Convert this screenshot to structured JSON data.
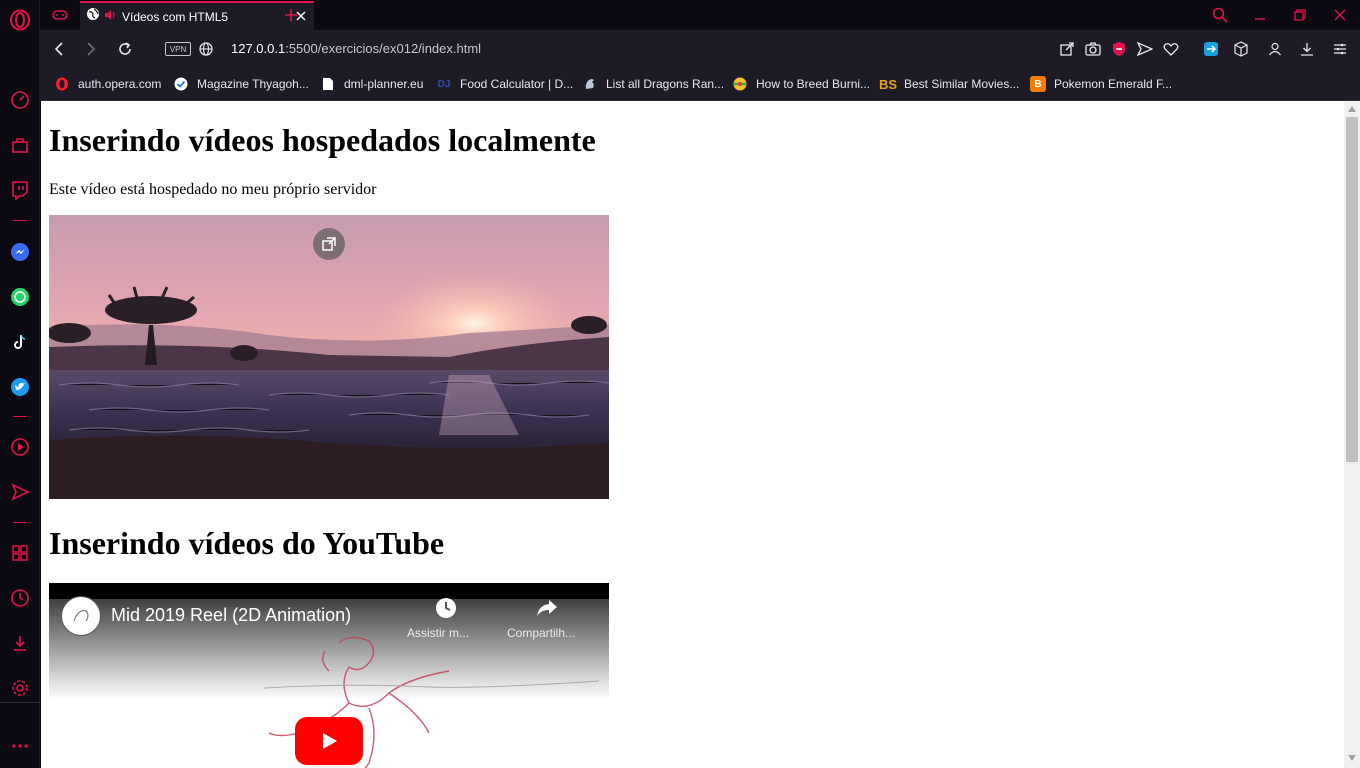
{
  "browser": {
    "tab": {
      "title": "Vídeos com HTML5"
    },
    "address": {
      "host": "127.0.0.1",
      "path": ":5500/exercicios/ex012/index.html",
      "vpn_label": "VPN"
    },
    "bookmarks": [
      {
        "label": "auth.opera.com",
        "icon": "opera-icon"
      },
      {
        "label": "Magazine Thyagoh...",
        "icon": "check-icon"
      },
      {
        "label": "dml-planner.eu",
        "icon": "document-icon"
      },
      {
        "label": "Food Calculator | D...",
        "icon": "dj-icon",
        "badge": "DJ"
      },
      {
        "label": "List all Dragons Ran...",
        "icon": "dragon-icon"
      },
      {
        "label": "How to Breed Burni...",
        "icon": "ball-icon"
      },
      {
        "label": "Best Similar Movies...",
        "icon": "bs-icon",
        "badge": "BS"
      },
      {
        "label": "Pokemon Emerald F...",
        "icon": "blogger-icon",
        "badge": "B"
      }
    ],
    "accent": "#e0144a"
  },
  "page": {
    "heading1": "Inserindo vídeos hospedados localmente",
    "paragraph": "Este vídeo está hospedado no meu próprio servidor",
    "heading2": "Inserindo vídeos do YouTube",
    "youtube": {
      "video_title": "Mid 2019 Reel (2D Animation)",
      "watch_later": "Assistir m...",
      "share": "Compartilh..."
    }
  }
}
